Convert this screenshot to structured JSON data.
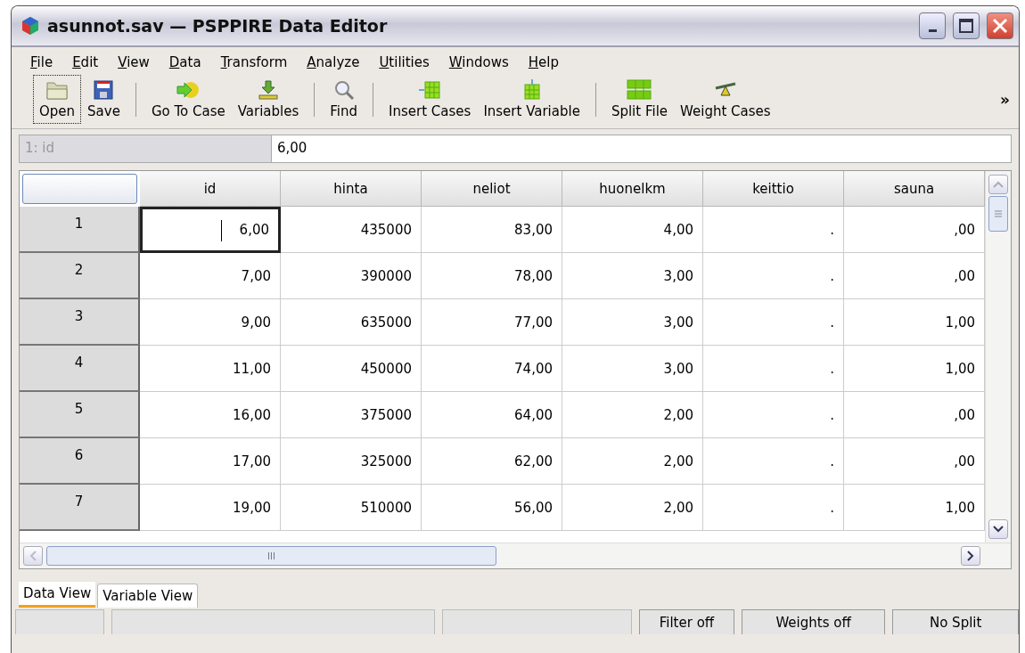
{
  "window": {
    "title": "asunnot.sav — PSPPIRE Data Editor"
  },
  "menu": [
    "File",
    "Edit",
    "View",
    "Data",
    "Transform",
    "Analyze",
    "Utilities",
    "Windows",
    "Help"
  ],
  "toolbar": [
    {
      "label": "Open",
      "focused": true
    },
    {
      "label": "Save",
      "focused": false
    },
    {
      "label": "Go To Case",
      "focused": false
    },
    {
      "label": "Variables",
      "focused": false
    },
    {
      "label": "Find",
      "focused": false
    },
    {
      "label": "Insert Cases",
      "focused": false
    },
    {
      "label": "Insert Variable",
      "focused": false
    },
    {
      "label": "Split File",
      "focused": false
    },
    {
      "label": "Weight Cases",
      "focused": false
    }
  ],
  "toolbar_overflow": "»",
  "cell_ref": {
    "name": "1: id",
    "value": "6,00"
  },
  "table": {
    "columns": [
      "id",
      "hinta",
      "neliot",
      "huonelkm",
      "keittio",
      "sauna"
    ],
    "rows": [
      {
        "label": "1",
        "selected": true,
        "cells": [
          "6,00",
          "435000",
          "83,00",
          "4,00",
          ".",
          ",00"
        ]
      },
      {
        "label": "2",
        "selected": false,
        "cells": [
          "7,00",
          "390000",
          "78,00",
          "3,00",
          ".",
          ",00"
        ]
      },
      {
        "label": "3",
        "selected": false,
        "cells": [
          "9,00",
          "635000",
          "77,00",
          "3,00",
          ".",
          "1,00"
        ]
      },
      {
        "label": "4",
        "selected": false,
        "cells": [
          "11,00",
          "450000",
          "74,00",
          "3,00",
          ".",
          "1,00"
        ]
      },
      {
        "label": "5",
        "selected": false,
        "cells": [
          "16,00",
          "375000",
          "64,00",
          "2,00",
          ".",
          ",00"
        ]
      },
      {
        "label": "6",
        "selected": false,
        "cells": [
          "17,00",
          "325000",
          "62,00",
          "2,00",
          ".",
          ",00"
        ]
      },
      {
        "label": "7",
        "selected": false,
        "cells": [
          "19,00",
          "510000",
          "56,00",
          "2,00",
          ".",
          "1,00"
        ]
      }
    ]
  },
  "scrollbar_grip": "III",
  "tabs": [
    {
      "label": "Data View",
      "selected": true
    },
    {
      "label": "Variable View",
      "selected": false
    }
  ],
  "status_bar": [
    "Filter off",
    "Weights off",
    "No Split"
  ]
}
